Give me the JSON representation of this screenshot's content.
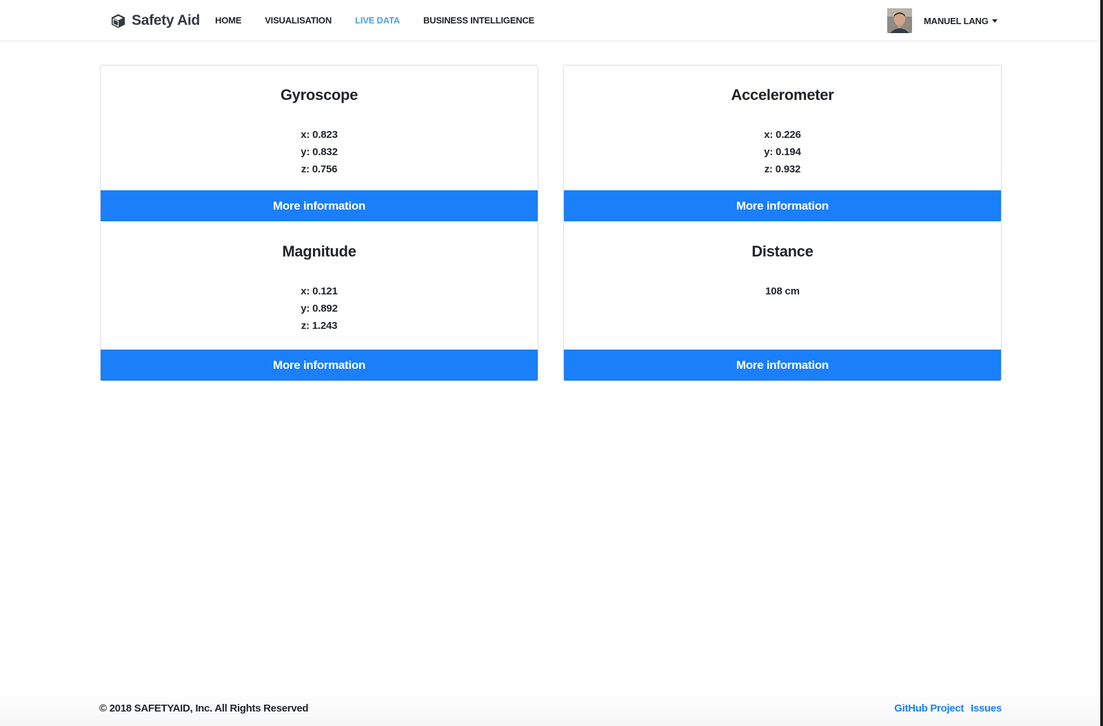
{
  "brand": {
    "name": "Safety Aid",
    "icon": "cube-icon"
  },
  "nav": {
    "items": [
      {
        "label": "HOME",
        "active": false
      },
      {
        "label": "VISUALISATION",
        "active": false
      },
      {
        "label": "LIVE DATA",
        "active": true
      },
      {
        "label": "BUSINESS INTELLIGENCE",
        "active": false
      }
    ]
  },
  "user": {
    "name": "MANUEL LANG",
    "avatar": "user-avatar"
  },
  "cards": {
    "gyroscope": {
      "title": "Gyroscope",
      "x": "x: 0.823",
      "y": "y: 0.832",
      "z": "z: 0.756",
      "button": "More information"
    },
    "accelerometer": {
      "title": "Accelerometer",
      "x": "x: 0.226",
      "y": "y: 0.194",
      "z": "z: 0.932",
      "button": "More information"
    },
    "magnitude": {
      "title": "Magnitude",
      "x": "x: 0.121",
      "y": "y: 0.892",
      "z": "z: 1.243",
      "button": "More information"
    },
    "distance": {
      "title": "Distance",
      "value": "108 cm",
      "button": "More information"
    }
  },
  "footer": {
    "copyright": "© 2018 SAFETYAID, Inc. All Rights Reserved",
    "links": {
      "github": "GitHub Project",
      "issues": "Issues"
    }
  },
  "colors": {
    "accent": "#1a7ff8",
    "nav_active": "#4aa3df",
    "text": "#212529"
  }
}
